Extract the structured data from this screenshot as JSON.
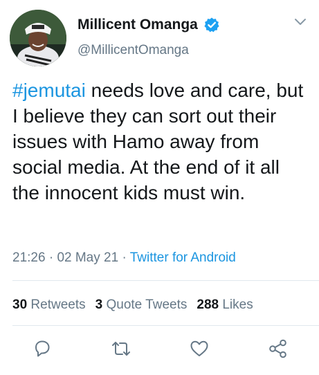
{
  "tweet": {
    "author_name": "Millicent Omanga",
    "handle": "@MillicentOmanga",
    "hashtag": "#jemutai",
    "text_after_hashtag": " needs love and care, but I believe they can sort out their issues with Hamo away from social media. At the end of it all the innocent kids must win.",
    "time": "21:26",
    "separator": " · ",
    "date": "02 May 21",
    "source": "Twitter for Android"
  },
  "stats": {
    "retweets_count": "30",
    "retweets_label": "Retweets",
    "quotes_count": "3",
    "quotes_label": "Quote Tweets",
    "likes_count": "288",
    "likes_label": "Likes"
  },
  "icons": {
    "verified": "verified-badge-icon",
    "menu": "chevron-down-icon",
    "reply": "reply-icon",
    "retweet": "retweet-icon",
    "like": "heart-icon",
    "share": "share-icon"
  },
  "colors": {
    "link": "#1b95e0",
    "secondary_text": "#657786",
    "primary_text": "#14171a",
    "verified": "#1da1f2"
  }
}
